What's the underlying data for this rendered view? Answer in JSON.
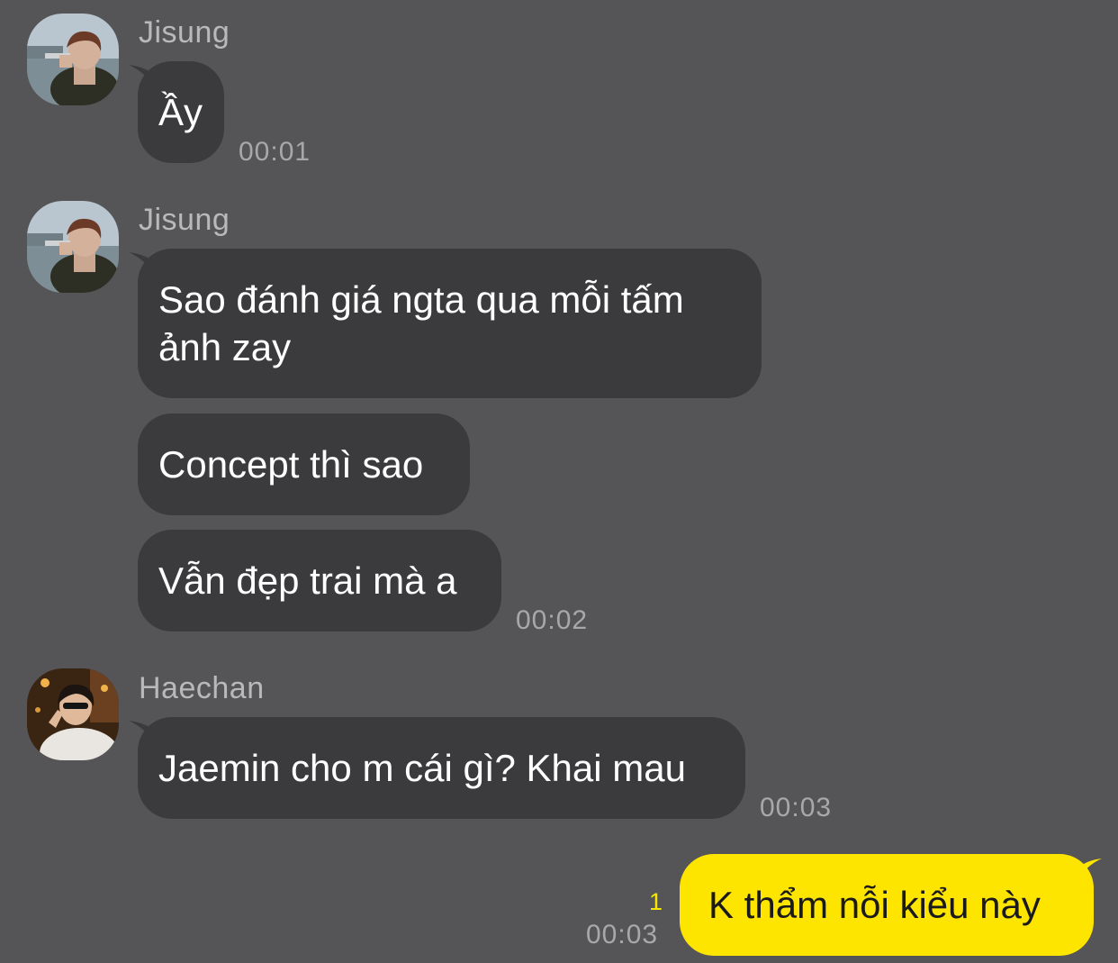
{
  "messages": [
    {
      "sender": "Jisung",
      "bubbles": [
        "Ầy"
      ],
      "time": "00:01"
    },
    {
      "sender": "Jisung",
      "bubbles": [
        "Sao đánh giá ngta qua mỗi tấm",
        "ảnh zay",
        "Concept thì sao",
        "Vẫn đẹp trai mà a"
      ],
      "time": "00:02"
    },
    {
      "sender": "Haechan",
      "bubbles": [
        "Jaemin cho m cái gì? Khai mau"
      ],
      "time": "00:03"
    }
  ],
  "outgoing": {
    "text": "K thẩm nỗi kiểu này",
    "time": "00:03",
    "unread_count": "1"
  },
  "colors": {
    "background": "#555456",
    "incoming_bubble": "#3b3b3d",
    "outgoing_bubble": "#fee500",
    "unread": "#f7e600"
  }
}
